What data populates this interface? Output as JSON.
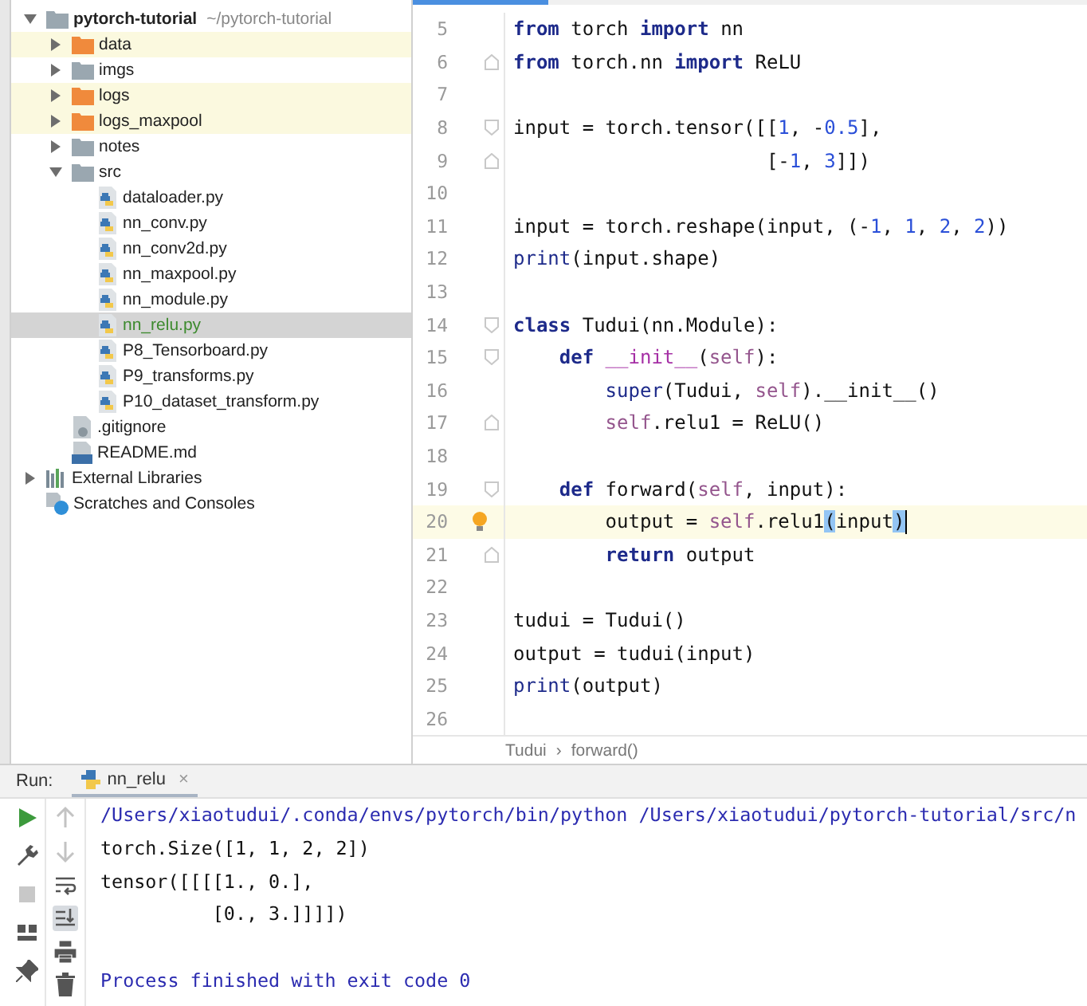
{
  "project_tree": [
    {
      "name": "pytorch-tutorial",
      "path": "~/pytorch-tutorial",
      "kind": "project",
      "expanded": true,
      "ignored": false,
      "selected": false,
      "children": [
        {
          "name": "data",
          "kind": "folder",
          "expanded": false,
          "ignored": true,
          "selected": false
        },
        {
          "name": "imgs",
          "kind": "folder",
          "expanded": false,
          "ignored": false,
          "selected": false
        },
        {
          "name": "logs",
          "kind": "folder",
          "expanded": false,
          "ignored": true,
          "selected": false
        },
        {
          "name": "logs_maxpool",
          "kind": "folder",
          "expanded": false,
          "ignored": true,
          "selected": false
        },
        {
          "name": "notes",
          "kind": "folder",
          "expanded": false,
          "ignored": false,
          "selected": false
        },
        {
          "name": "src",
          "kind": "folder",
          "expanded": true,
          "ignored": false,
          "selected": false,
          "children": [
            {
              "name": "dataloader.py",
              "kind": "python",
              "ignored": false,
              "selected": false
            },
            {
              "name": "nn_conv.py",
              "kind": "python",
              "ignored": false,
              "selected": false
            },
            {
              "name": "nn_conv2d.py",
              "kind": "python",
              "ignored": false,
              "selected": false
            },
            {
              "name": "nn_maxpool.py",
              "kind": "python",
              "ignored": false,
              "selected": false
            },
            {
              "name": "nn_module.py",
              "kind": "python",
              "ignored": false,
              "selected": false
            },
            {
              "name": "nn_relu.py",
              "kind": "python",
              "ignored": false,
              "selected": true
            },
            {
              "name": "P8_Tensorboard.py",
              "kind": "python",
              "ignored": false,
              "selected": false
            },
            {
              "name": "P9_transforms.py",
              "kind": "python",
              "ignored": false,
              "selected": false
            },
            {
              "name": "P10_dataset_transform.py",
              "kind": "python",
              "ignored": false,
              "selected": false
            }
          ]
        },
        {
          "name": ".gitignore",
          "kind": "text",
          "ignored": false,
          "selected": false
        },
        {
          "name": "README.md",
          "kind": "markdown",
          "ignored": false,
          "selected": false
        }
      ]
    },
    {
      "name": "External Libraries",
      "kind": "library",
      "expanded": false,
      "ignored": false,
      "selected": false
    },
    {
      "name": "Scratches and Consoles",
      "kind": "scratches",
      "ignored": false,
      "selected": false
    }
  ],
  "editor": {
    "lines": [
      {
        "number": "5",
        "tokens": [
          {
            "kind": "keyword",
            "text": "from"
          },
          {
            "kind": "plain",
            "text": " torch "
          },
          {
            "kind": "keyword",
            "text": "import"
          },
          {
            "kind": "plain",
            "text": " nn"
          }
        ]
      },
      {
        "number": "6",
        "marker": {
          "kind": "fold-end"
        },
        "tokens": [
          {
            "kind": "keyword",
            "text": "from"
          },
          {
            "kind": "plain",
            "text": " torch.nn "
          },
          {
            "kind": "keyword",
            "text": "import"
          },
          {
            "kind": "plain",
            "text": " ReLU"
          }
        ]
      },
      {
        "number": "7"
      },
      {
        "number": "8",
        "marker": {
          "kind": "fold-start"
        },
        "tokens": [
          {
            "kind": "plain",
            "text": "input = torch.tensor([["
          },
          {
            "kind": "number",
            "text": "1"
          },
          {
            "kind": "plain",
            "text": ", -"
          },
          {
            "kind": "number",
            "text": "0.5"
          },
          {
            "kind": "plain",
            "text": "],"
          }
        ]
      },
      {
        "number": "9",
        "marker": {
          "kind": "fold-end"
        },
        "tokens": [
          {
            "kind": "plain",
            "text": "                      [-"
          },
          {
            "kind": "number",
            "text": "1"
          },
          {
            "kind": "plain",
            "text": ", "
          },
          {
            "kind": "number",
            "text": "3"
          },
          {
            "kind": "plain",
            "text": "]])"
          }
        ]
      },
      {
        "number": "10"
      },
      {
        "number": "11",
        "tokens": [
          {
            "kind": "plain",
            "text": "input = torch.reshape(input, (-"
          },
          {
            "kind": "number",
            "text": "1"
          },
          {
            "kind": "plain",
            "text": ", "
          },
          {
            "kind": "number",
            "text": "1"
          },
          {
            "kind": "plain",
            "text": ", "
          },
          {
            "kind": "number",
            "text": "2"
          },
          {
            "kind": "plain",
            "text": ", "
          },
          {
            "kind": "number",
            "text": "2"
          },
          {
            "kind": "plain",
            "text": "))"
          }
        ]
      },
      {
        "number": "12",
        "tokens": [
          {
            "kind": "builtin",
            "text": "print"
          },
          {
            "kind": "plain",
            "text": "(input.shape)"
          }
        ]
      },
      {
        "number": "13"
      },
      {
        "number": "14",
        "marker": {
          "kind": "fold-start"
        },
        "tokens": [
          {
            "kind": "keyword",
            "text": "class"
          },
          {
            "kind": "plain",
            "text": " Tudui(nn.Module):"
          }
        ]
      },
      {
        "number": "15",
        "marker": {
          "kind": "fold-start"
        },
        "tokens": [
          {
            "kind": "keyword",
            "text": "    def "
          },
          {
            "kind": "dunder",
            "text": "__init__"
          },
          {
            "kind": "plain",
            "text": "("
          },
          {
            "kind": "self",
            "text": "self"
          },
          {
            "kind": "plain",
            "text": "):"
          }
        ]
      },
      {
        "number": "16",
        "tokens": [
          {
            "kind": "builtin",
            "text": "        super"
          },
          {
            "kind": "plain",
            "text": "(Tudui, "
          },
          {
            "kind": "self",
            "text": "self"
          },
          {
            "kind": "plain",
            "text": ").__init__()"
          }
        ]
      },
      {
        "number": "17",
        "marker": {
          "kind": "fold-end"
        },
        "tokens": [
          {
            "kind": "self",
            "text": "        self"
          },
          {
            "kind": "plain",
            "text": ".relu1 = ReLU()"
          }
        ]
      },
      {
        "number": "18"
      },
      {
        "number": "19",
        "marker": {
          "kind": "fold-start"
        },
        "tokens": [
          {
            "kind": "keyword",
            "text": "    def"
          },
          {
            "kind": "plain",
            "text": " forward("
          },
          {
            "kind": "self",
            "text": "self"
          },
          {
            "kind": "plain",
            "text": ", input):"
          }
        ]
      },
      {
        "number": "20",
        "current": true,
        "marker": {
          "kind": "bulb"
        },
        "tokens": [
          {
            "kind": "plain",
            "text": "        output = "
          },
          {
            "kind": "self",
            "text": "self"
          },
          {
            "kind": "plain",
            "text": ".relu1"
          },
          {
            "kind": "match",
            "text": "("
          },
          {
            "kind": "plain",
            "text": "input"
          },
          {
            "kind": "match",
            "text": ")"
          }
        ]
      },
      {
        "number": "21",
        "marker": {
          "kind": "fold-end"
        },
        "tokens": [
          {
            "kind": "keyword",
            "text": "        return"
          },
          {
            "kind": "plain",
            "text": " output"
          }
        ]
      },
      {
        "number": "22"
      },
      {
        "number": "23",
        "tokens": [
          {
            "kind": "plain",
            "text": "tudui = Tudui()"
          }
        ]
      },
      {
        "number": "24",
        "tokens": [
          {
            "kind": "plain",
            "text": "output = tudui(input)"
          }
        ]
      },
      {
        "number": "25",
        "tokens": [
          {
            "kind": "builtin",
            "text": "print"
          },
          {
            "kind": "plain",
            "text": "(output)"
          }
        ]
      },
      {
        "number": "26"
      }
    ],
    "breadcrumb": [
      "Tudui",
      "forward()"
    ],
    "breadcrumb_separator": "›"
  },
  "run_panel": {
    "label": "Run:",
    "tab": {
      "title": "nn_relu",
      "close": "×",
      "selected": true
    },
    "toolbar_1": [
      {
        "kind": "run",
        "disabled": false
      },
      {
        "kind": "settings",
        "disabled": false
      },
      {
        "kind": "stop",
        "disabled": true
      },
      {
        "kind": "layout",
        "disabled": false
      },
      {
        "kind": "pin",
        "disabled": false
      }
    ],
    "toolbar_2": [
      {
        "kind": "up",
        "disabled": true,
        "on": false
      },
      {
        "kind": "down",
        "disabled": true,
        "on": false
      },
      {
        "kind": "wrap",
        "disabled": false,
        "on": false
      },
      {
        "kind": "scroll-end",
        "disabled": false,
        "on": true
      },
      {
        "kind": "print",
        "disabled": false,
        "on": false
      },
      {
        "kind": "trash",
        "disabled": false,
        "on": false
      }
    ],
    "console": [
      {
        "kind": "command",
        "text": "/Users/xiaotudui/.conda/envs/pytorch/bin/python /Users/xiaotudui/pytorch-tutorial/src/n"
      },
      {
        "kind": "output",
        "text": "torch.Size([1, 1, 2, 2])"
      },
      {
        "kind": "output",
        "text": "tensor([[[[1., 0.],"
      },
      {
        "kind": "output",
        "text": "          [0., 3.]]]])"
      },
      {
        "kind": "blank"
      },
      {
        "kind": "status",
        "text": "Process finished with exit code 0"
      }
    ]
  }
}
